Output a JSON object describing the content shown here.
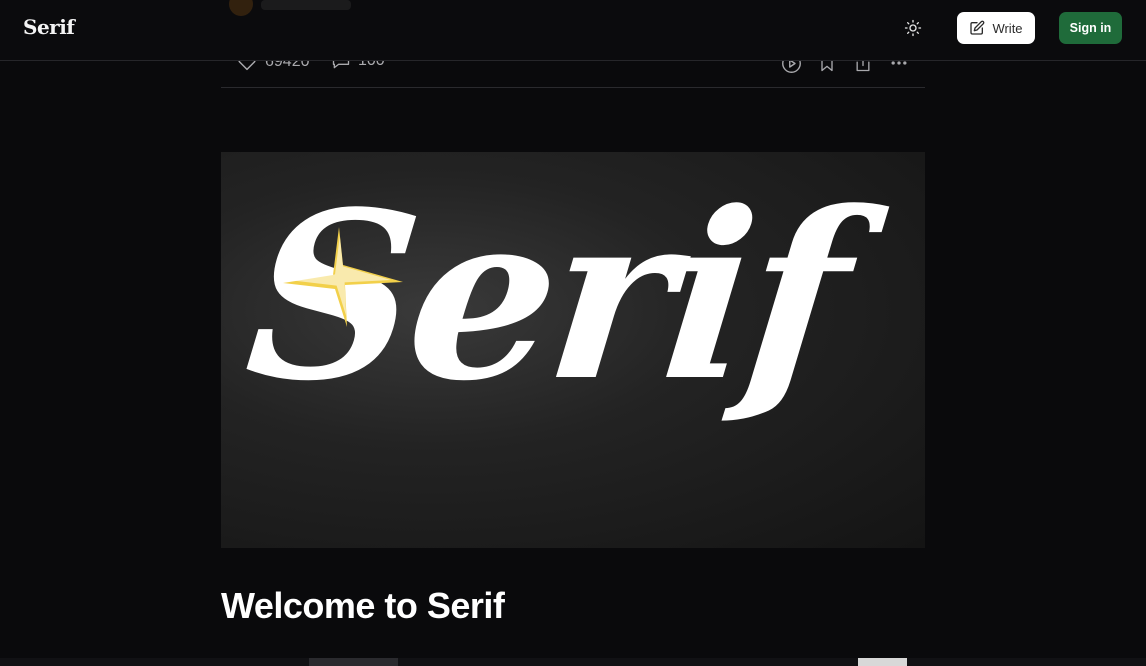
{
  "header": {
    "logo": "Serif",
    "write_label": "Write",
    "signin_label": "Sign in"
  },
  "actions": {
    "likes": "69420",
    "comments": "100"
  },
  "hero": {
    "logo_text": "Serif"
  },
  "article": {
    "title": "Welcome to Serif"
  },
  "colors": {
    "background": "#0a0a0c",
    "signin": "#1f6b3a",
    "write": "#ffffff",
    "star": "#f2d04a"
  },
  "icons": [
    "sun-icon",
    "edit-icon",
    "heart-icon",
    "comment-icon",
    "play-circle-icon",
    "bookmark-icon",
    "share-icon",
    "more-icon",
    "sparkle-star-icon"
  ]
}
